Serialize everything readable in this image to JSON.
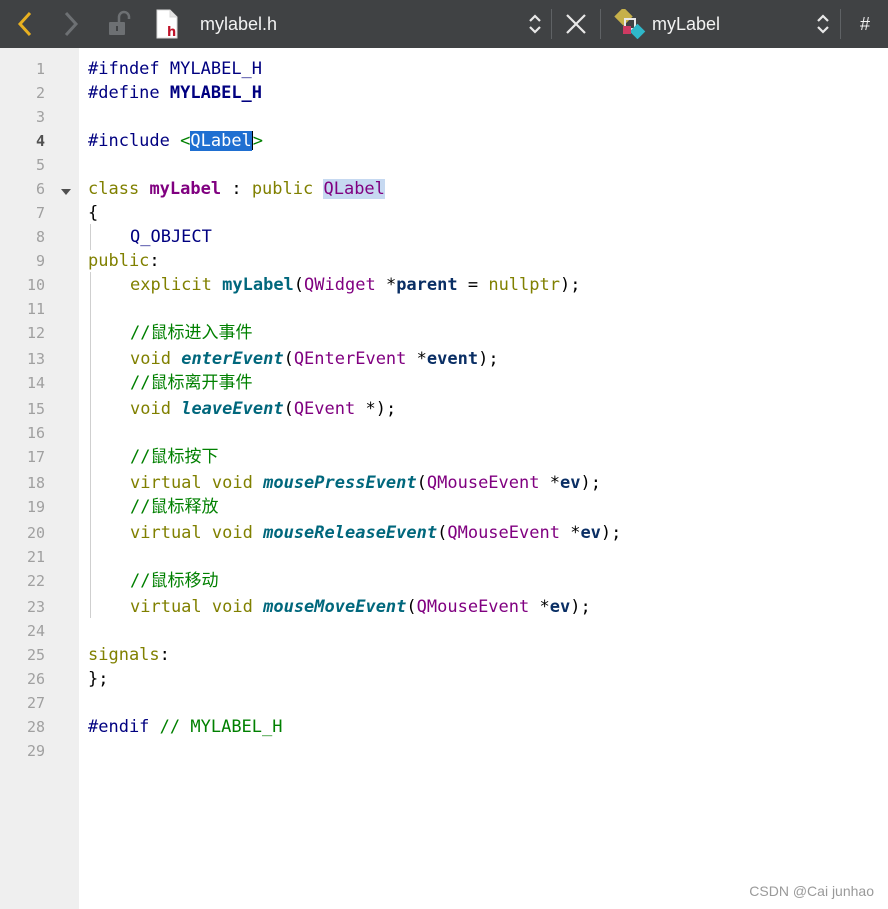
{
  "toolbar": {
    "file_name": "mylabel.h",
    "file_type_letter": "h",
    "symbol_name": "myLabel",
    "hash_label": "#"
  },
  "editor": {
    "current_line": 4,
    "lines": [
      {
        "n": "1"
      },
      {
        "n": "2"
      },
      {
        "n": "3"
      },
      {
        "n": "4"
      },
      {
        "n": "5"
      },
      {
        "n": "6"
      },
      {
        "n": "7"
      },
      {
        "n": "8"
      },
      {
        "n": "9"
      },
      {
        "n": "10"
      },
      {
        "n": "11"
      },
      {
        "n": "12"
      },
      {
        "n": "13"
      },
      {
        "n": "14"
      },
      {
        "n": "15"
      },
      {
        "n": "16"
      },
      {
        "n": "17"
      },
      {
        "n": "18"
      },
      {
        "n": "19"
      },
      {
        "n": "20"
      },
      {
        "n": "21"
      },
      {
        "n": "22"
      },
      {
        "n": "23"
      },
      {
        "n": "24"
      },
      {
        "n": "25"
      },
      {
        "n": "26"
      },
      {
        "n": "27"
      },
      {
        "n": "28"
      },
      {
        "n": "29"
      }
    ],
    "code": {
      "l1": {
        "a": "#ifndef",
        "b": " ",
        "c": "MYLABEL_H"
      },
      "l2": {
        "a": "#define",
        "b": " ",
        "c": "MYLABEL_H"
      },
      "l4": {
        "a": "#include",
        "b": " <",
        "c": "QLabel",
        "d": ">"
      },
      "l6": {
        "a": "class",
        "b": " ",
        "c": "myLabel",
        "d": " : ",
        "e": "public",
        "f": " ",
        "g": "QLabel"
      },
      "l7": {
        "a": "{"
      },
      "l8": {
        "a": "Q_OBJECT"
      },
      "l9": {
        "a": "public",
        "b": ":"
      },
      "l10": {
        "a": "explicit",
        "b": " ",
        "c": "myLabel",
        "d": "(",
        "e": "QWidget",
        "f": " *",
        "g": "parent",
        "h": " = ",
        "i": "nullptr",
        "j": ");"
      },
      "l12": {
        "a": "//鼠标进入事件"
      },
      "l13": {
        "a": "void",
        "b": " ",
        "c": "enterEvent",
        "d": "(",
        "e": "QEnterEvent",
        "f": " *",
        "g": "event",
        "h": ");"
      },
      "l14": {
        "a": "//鼠标离开事件"
      },
      "l15": {
        "a": "void",
        "b": " ",
        "c": "leaveEvent",
        "d": "(",
        "e": "QEvent",
        "f": " *);"
      },
      "l17": {
        "a": "//鼠标按下"
      },
      "l18": {
        "a": "virtual",
        "b": " ",
        "c": "void",
        "d": " ",
        "e": "mousePressEvent",
        "f": "(",
        "g": "QMouseEvent",
        "h": " *",
        "i": "ev",
        "j": ");"
      },
      "l19": {
        "a": "//鼠标释放"
      },
      "l20": {
        "a": "virtual",
        "b": " ",
        "c": "void",
        "d": " ",
        "e": "mouseReleaseEvent",
        "f": "(",
        "g": "QMouseEvent",
        "h": " *",
        "i": "ev",
        "j": ");"
      },
      "l22": {
        "a": "//鼠标移动"
      },
      "l23": {
        "a": "virtual",
        "b": " ",
        "c": "void",
        "d": " ",
        "e": "mouseMoveEvent",
        "f": "(",
        "g": "QMouseEvent",
        "h": " *",
        "i": "ev",
        "j": ");"
      },
      "l25": {
        "a": "signals",
        "b": ":"
      },
      "l26": {
        "a": "};"
      },
      "l28": {
        "a": "#endif",
        "b": " ",
        "c": "// MYLABEL_H"
      }
    }
  },
  "watermark": "CSDN @Cai junhao",
  "colors": {
    "toolbar_bg": "#404244",
    "gutter_bg": "#efefef",
    "back_arrow": "#e8b020",
    "selection": "#1f6fd1"
  }
}
